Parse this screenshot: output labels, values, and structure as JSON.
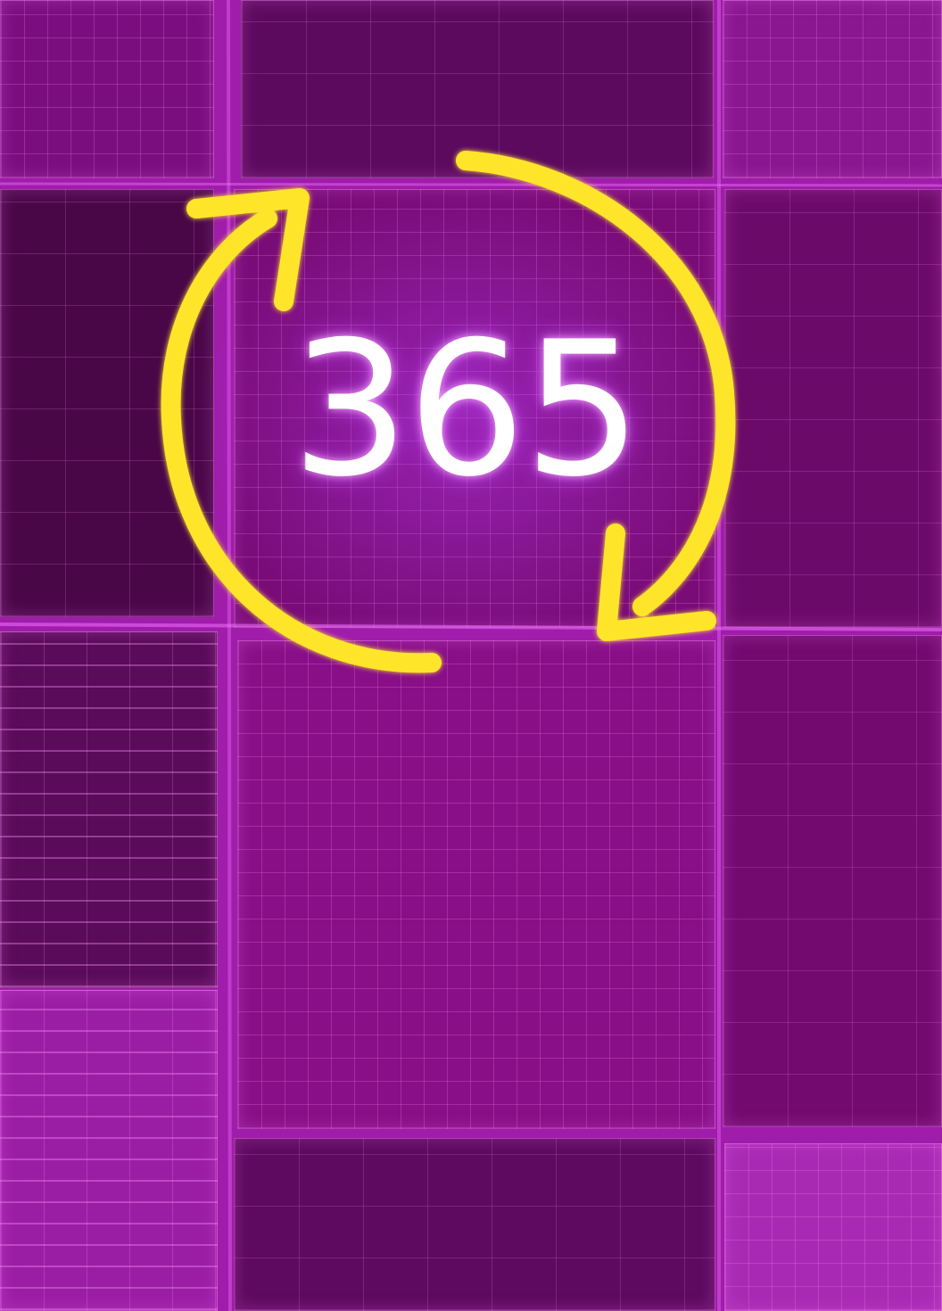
{
  "graphic": {
    "number_text": "365",
    "number_color": "#ffffff",
    "arrow_color": "#ffe52a",
    "icon": "circular-refresh-arrows-icon"
  },
  "background": {
    "base_color": "#a01caa",
    "grid_glow_color": "#e060ff",
    "dark_tile_color": "#4a0748",
    "mid_tile_color": "#7a0c78",
    "pattern": "glowing-grid-tiles"
  }
}
